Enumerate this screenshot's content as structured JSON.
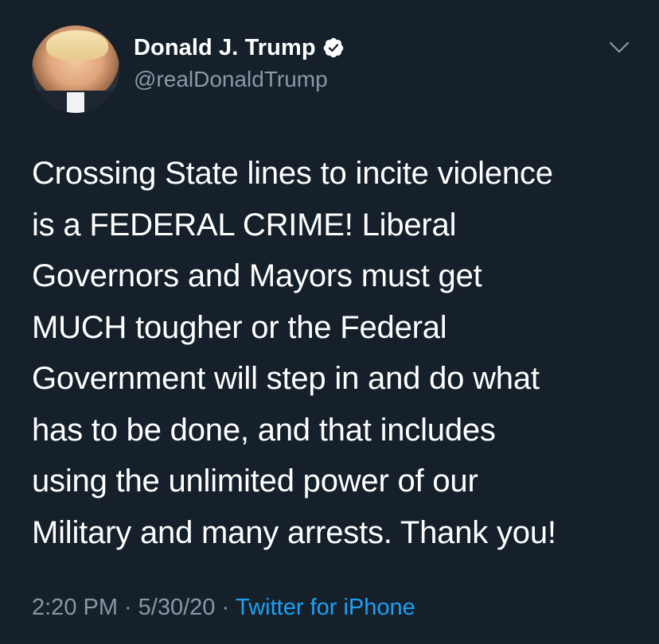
{
  "author": {
    "name": "Donald J. Trump",
    "handle": "@realDonaldTrump",
    "verified": true,
    "avatar_icon": "profile-photo"
  },
  "tweet": {
    "text": "Crossing State lines to incite violence\nis a FEDERAL CRIME! Liberal\nGovernors and Mayors must get\nMUCH tougher or the Federal\nGovernment will step in and do what\nhas to be done, and that includes\nusing the unlimited power of our\nMilitary and many arrests. Thank you!",
    "time": "2:20 PM",
    "date": "5/30/20",
    "separator": "·",
    "source": "Twitter for iPhone"
  },
  "menu": {
    "icon": "chevron-down-icon"
  },
  "colors": {
    "background": "#15202b",
    "primary_text": "#ffffff",
    "secondary_text": "#8899a6",
    "link": "#1da1f2",
    "verified_badge": "#ffffff"
  }
}
